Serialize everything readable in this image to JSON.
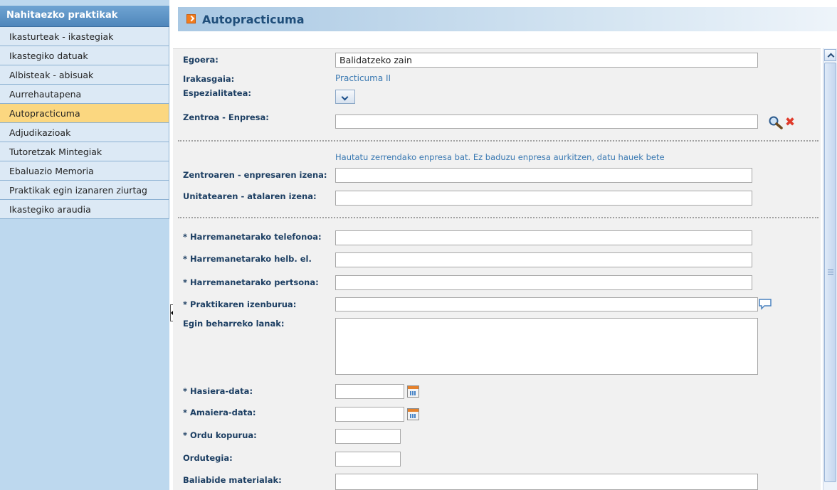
{
  "sidebar": {
    "header": "Nahitaezko praktikak",
    "items": [
      {
        "label": "Ikasturteak - ikastegiak",
        "active": false
      },
      {
        "label": "Ikastegiko datuak",
        "active": false
      },
      {
        "label": "Albisteak - abisuak",
        "active": false
      },
      {
        "label": "Aurrehautapena",
        "active": false
      },
      {
        "label": "Autopracticuma",
        "active": true
      },
      {
        "label": "Adjudikazioak",
        "active": false
      },
      {
        "label": "Tutoretzak Mintegiak",
        "active": false
      },
      {
        "label": "Ebaluazio Memoria",
        "active": false
      },
      {
        "label": "Praktikak egin izanaren ziurtag",
        "active": false
      },
      {
        "label": "Ikastegiko araudia",
        "active": false
      }
    ]
  },
  "page": {
    "title": "Autopracticuma"
  },
  "form": {
    "egoera_label": "Egoera:",
    "egoera_value": "Balidatzeko zain",
    "irakasgaia_label": "Irakasgaia:",
    "irakasgaia_value": "Practicuma II",
    "espezialitatea_label": "Espezialitatea:",
    "zentroa_label": "Zentroa - Enpresa:",
    "zentroa_value": "",
    "hint": "Hautatu zerrendako enpresa bat. Ez baduzu enpresa aurkitzen, datu hauek bete",
    "zentroaren_izena_label": "Zentroaren - enpresaren izena:",
    "unitatea_label": "Unitatearen - atalaren izena:",
    "telefonoa_label": "* Harremanetarako telefonoa:",
    "helb_label": "* Harremanetarako helb. el.",
    "pertsona_label": "* Harremanetarako pertsona:",
    "izenburua_label": "* Praktikaren izenburua:",
    "lanak_label": "Egin beharreko lanak:",
    "hasiera_label": "* Hasiera-data:",
    "amaiera_label": "* Amaiera-data:",
    "ordu_label": "* Ordu kopurua:",
    "ordutegia_label": "Ordutegia:",
    "baliabide_label": "Baliabide materialak:"
  },
  "colors": {
    "sidebar_bg": "#bdd8ee",
    "active_item": "#fbd780",
    "label": "#1d3f63",
    "value": "#3a79b2"
  }
}
